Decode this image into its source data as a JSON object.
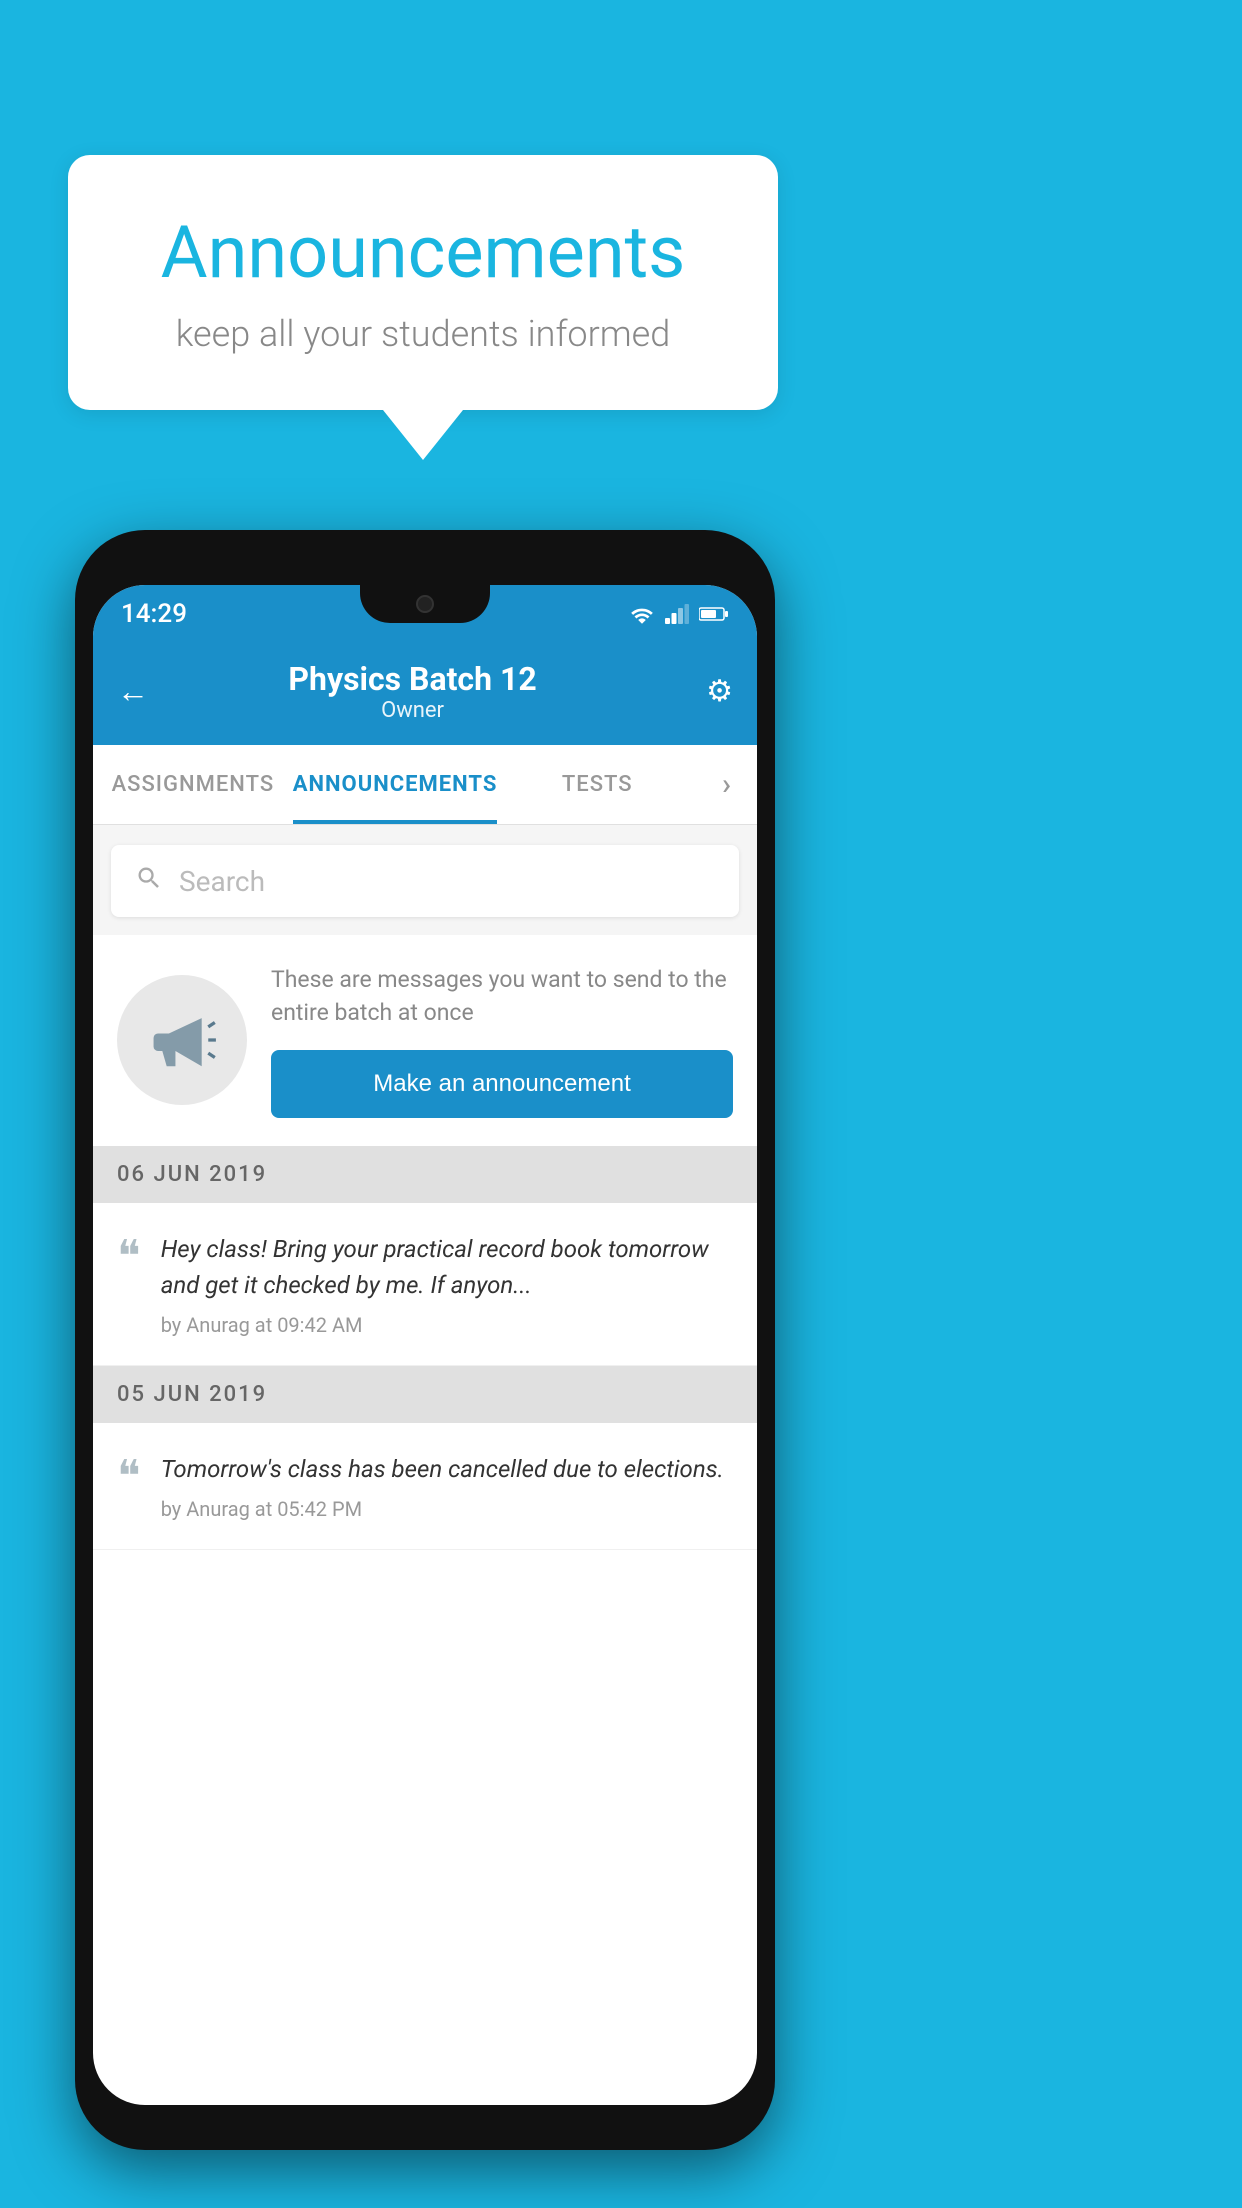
{
  "page": {
    "background_color": "#1ab5e0"
  },
  "speech_bubble": {
    "title": "Announcements",
    "subtitle": "keep all your students informed"
  },
  "app_bar": {
    "title": "Physics Batch 12",
    "subtitle": "Owner",
    "back_icon": "←",
    "settings_icon": "⚙"
  },
  "tabs": [
    {
      "label": "ASSIGNMENTS",
      "active": false
    },
    {
      "label": "ANNOUNCEMENTS",
      "active": true
    },
    {
      "label": "TESTS",
      "active": false
    },
    {
      "label": "...",
      "active": false
    }
  ],
  "search": {
    "placeholder": "Search"
  },
  "promo": {
    "description": "These are messages you want to send to the entire batch at once",
    "button_label": "Make an announcement"
  },
  "announcements": [
    {
      "date": "06  JUN  2019",
      "message": "Hey class! Bring your practical record book tomorrow and get it checked by me. If anyon...",
      "meta": "by Anurag at 09:42 AM"
    },
    {
      "date": "05  JUN  2019",
      "message": "Tomorrow's class has been cancelled due to elections.",
      "meta": "by Anurag at 05:42 PM"
    }
  ],
  "status_bar": {
    "time": "14:29"
  }
}
